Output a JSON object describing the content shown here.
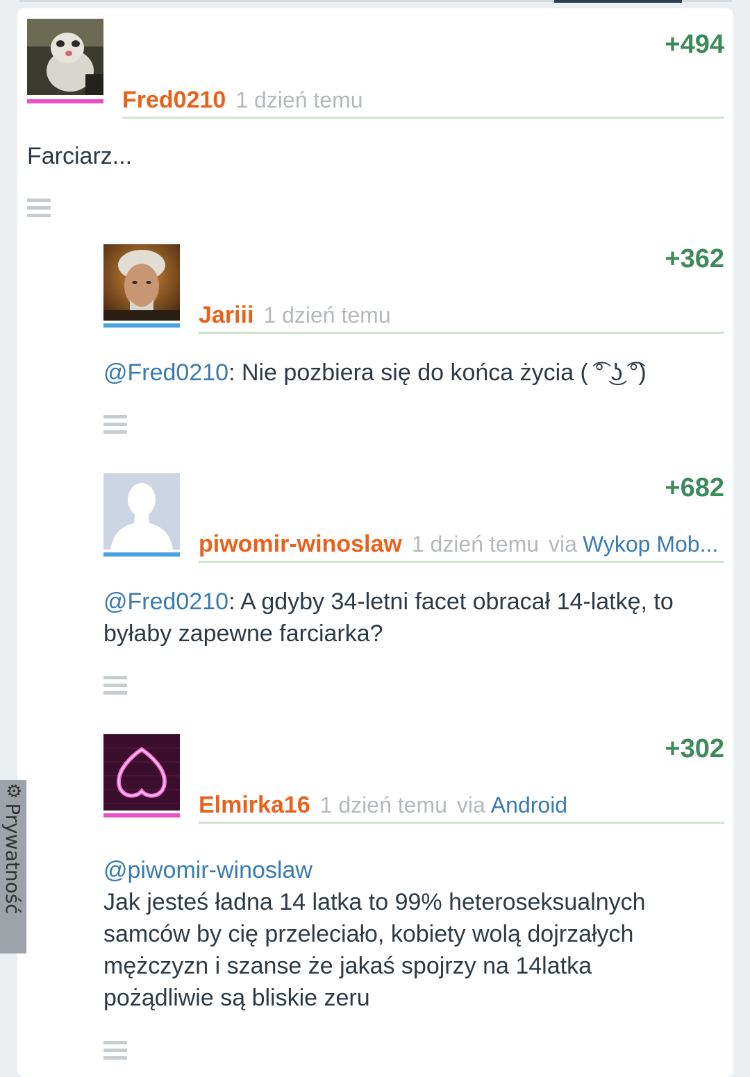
{
  "comments": [
    {
      "author": "Fred0210",
      "time": "1 dzień temu",
      "score": "+494",
      "text": "Farciarz...",
      "avatar": "ferret-photo-avatar",
      "sex_color": "#e84fc4"
    },
    {
      "author": "Jariii",
      "time": "1 dzień temu",
      "score": "+362",
      "mention": "@Fred0210",
      "text": ": Nie pozbiera się do końca życia ( ͡° ͜ʖ ͡°)",
      "avatar": "old-man-photo-avatar",
      "sex_color": "#4aa3df"
    },
    {
      "author": "piwomir-winoslaw",
      "time": "1 dzień temu",
      "via": "via",
      "via_app": "Wykop Mob...",
      "score": "+682",
      "mention": "@Fred0210",
      "text_line1": ": A gdyby 34-letni facet obracał 14-latkę, to",
      "text_line2": "byłaby zapewne farciarka?",
      "avatar": "default-silhouette-avatar",
      "sex_color": "#4aa3df"
    },
    {
      "author": "Elmirka16",
      "time": "1 dzień temu",
      "via": "via",
      "via_app": "Android",
      "score": "+302",
      "mention": "@piwomir-winoslaw",
      "lines": [
        "Jak jesteś ładna 14 latka to 99% heteroseksualnych",
        "samców by cię przeleciało, kobiety wolą dojrzałych",
        "mężczyzn i szanse że jakaś spojrzy na 14latka",
        "pożądliwie są bliskie zeru"
      ],
      "avatar": "neon-heart-avatar",
      "sex_color": "#e84fc4"
    }
  ],
  "privacy": {
    "label": "Prywatność",
    "icon": "gear-icon"
  },
  "colors": {
    "author": "#e8621d",
    "score": "#3c8a5a",
    "link": "#3a7ab0"
  }
}
